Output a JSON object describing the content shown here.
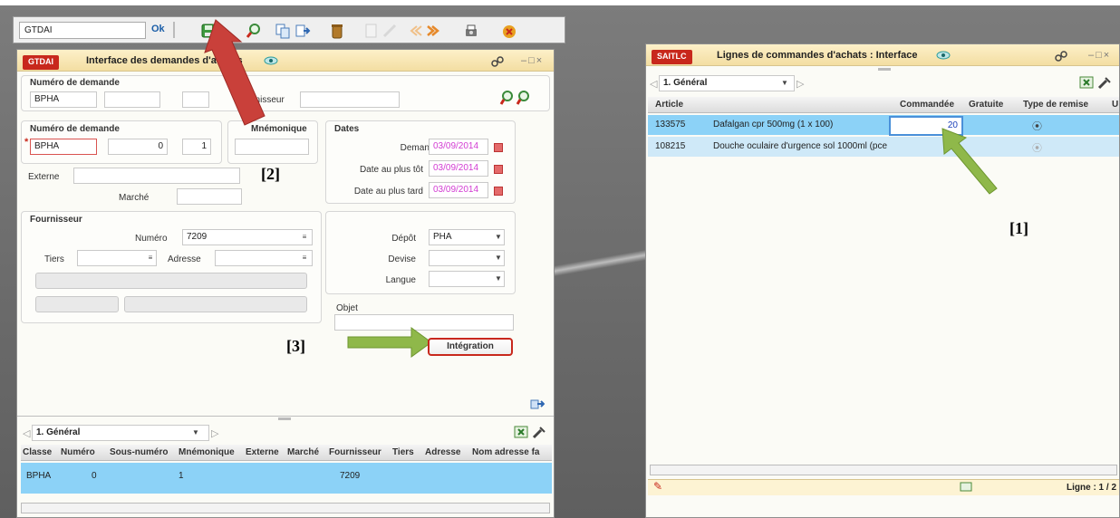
{
  "toolbar": {
    "input_value": "GTDAI",
    "ok_label": "Ok"
  },
  "left_window": {
    "tag": "GTDAI",
    "title": "Interface des demandes d'achats",
    "search_section": {
      "label": "Numéro de demande",
      "value": "BPHA",
      "supplier_label": "Fournisseur"
    },
    "request": {
      "label": "Numéro de demande",
      "code": "BPHA",
      "num": "0",
      "sub": "1",
      "mnemo_label": "Mnémonique"
    },
    "externe_label": "Externe",
    "marche_label": "Marché",
    "dates": {
      "title": "Dates",
      "demande_label": "Demande",
      "demande": "03/09/2014",
      "tot_label": "Date au plus tôt",
      "tot": "03/09/2014",
      "tard_label": "Date au plus tard",
      "tard": "03/09/2014"
    },
    "supplier": {
      "title": "Fournisseur",
      "numero_label": "Numéro",
      "numero": "7209",
      "tiers_label": "Tiers",
      "adresse_label": "Adresse"
    },
    "depot": {
      "depot_label": "Dépôt",
      "depot": "PHA",
      "devise_label": "Devise",
      "langue_label": "Langue"
    },
    "objet_label": "Objet",
    "integration_button": "Intégration",
    "grid": {
      "tab": "1. Général",
      "columns": [
        "Classe",
        "Numéro",
        "Sous-numéro",
        "Mnémonique",
        "Externe",
        "Marché",
        "Fournisseur",
        "Tiers",
        "Adresse",
        "Nom adresse fa"
      ],
      "row": {
        "classe": "BPHA",
        "numero": "0",
        "sous_numero": "1",
        "fournisseur": "7209"
      }
    }
  },
  "right_window": {
    "tag": "SAITLC",
    "title": "Lignes de commandes d'achats : Interface",
    "tab": "1. Général",
    "columns": [
      "Article",
      "Commandée",
      "Gratuite",
      "Type de remise",
      "U"
    ],
    "rows": [
      {
        "article": "133575",
        "designation": "Dafalgan cpr 500mg (1 x 100)",
        "commandee": "20"
      },
      {
        "article": "108215",
        "designation": "Douche oculaire d'urgence sol 1000ml (pce",
        "commandee": ""
      }
    ],
    "status": "Ligne : 1 / 2"
  },
  "annotations": {
    "a1": "[1]",
    "a2": "[2]",
    "a3": "[3]"
  },
  "colors": {
    "arrow_green": "#8fb84a",
    "arrow_red": "#c9403a",
    "tag_red": "#c8281c",
    "selected_row": "#8cd2f7"
  }
}
